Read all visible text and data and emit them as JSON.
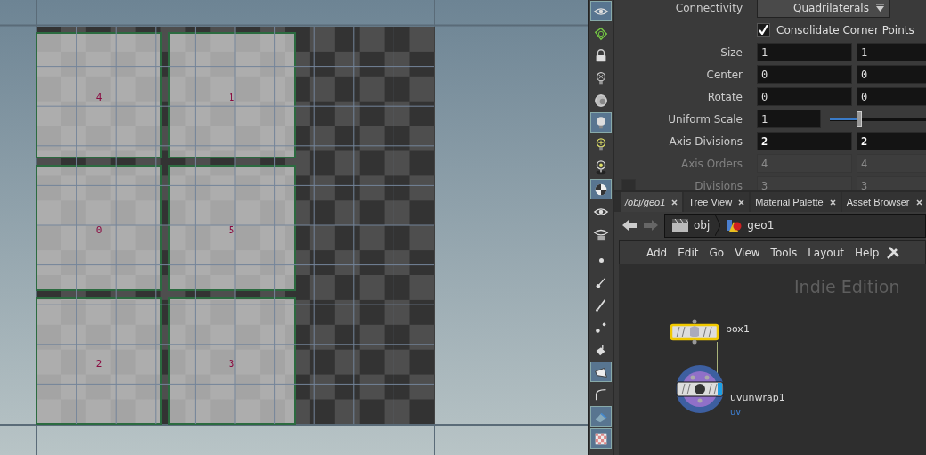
{
  "viewport": {
    "islands": [
      {
        "label": "4"
      },
      {
        "label": "1"
      },
      {
        "label": "0"
      },
      {
        "label": "5"
      },
      {
        "label": "2"
      },
      {
        "label": "3"
      }
    ]
  },
  "toolbar": {
    "groups": [
      [
        {
          "kind": "eye",
          "selected": true
        },
        {
          "kind": "wire",
          "selected": false
        },
        {
          "kind": "lock",
          "selected": false
        },
        {
          "kind": "bulb-x",
          "selected": false
        },
        {
          "kind": "sphere",
          "selected": false
        },
        {
          "kind": "bulb",
          "selected": true
        },
        {
          "kind": "bulb-plus",
          "selected": false
        },
        {
          "kind": "bulb-pin",
          "selected": false
        },
        {
          "kind": "ball",
          "selected": true
        },
        {
          "kind": "eye",
          "selected": false
        },
        {
          "kind": "eye-cam",
          "selected": false
        }
      ],
      [
        {
          "kind": "dot",
          "selected": false
        },
        {
          "kind": "brush",
          "selected": false
        },
        {
          "kind": "pen",
          "selected": false
        },
        {
          "kind": "points",
          "selected": false
        },
        {
          "kind": "bucket",
          "selected": false
        },
        {
          "kind": "tag",
          "selected": true
        },
        {
          "kind": "curve",
          "selected": false
        },
        {
          "kind": "plane",
          "selected": true
        },
        {
          "kind": "checker",
          "selected": true
        }
      ]
    ]
  },
  "parameters": [
    {
      "kind": "menu",
      "label": "Connectivity",
      "value": "Quadrilaterals"
    },
    {
      "kind": "toggle",
      "label": "Consolidate Corner Points",
      "checked": true
    },
    {
      "kind": "vector",
      "label": "Size",
      "values": [
        "1",
        "1"
      ],
      "changed": false,
      "disabled": false
    },
    {
      "kind": "vector",
      "label": "Center",
      "values": [
        "0",
        "0"
      ],
      "changed": false,
      "disabled": false
    },
    {
      "kind": "vector",
      "label": "Rotate",
      "values": [
        "0",
        "0"
      ],
      "changed": false,
      "disabled": false
    },
    {
      "kind": "slider",
      "label": "Uniform Scale",
      "value": "1",
      "level": 0.22
    },
    {
      "kind": "vector",
      "label": "Axis Divisions",
      "values": [
        "2",
        "2"
      ],
      "changed": true,
      "disabled": false
    },
    {
      "kind": "vector",
      "label": "Axis Orders",
      "values": [
        "4",
        "4"
      ],
      "changed": false,
      "disabled": true
    },
    {
      "kind": "toggled-vector",
      "label": "Divisions",
      "values": [
        "3",
        "3"
      ],
      "checked": false,
      "changed": false,
      "disabled": true
    }
  ],
  "tabs": [
    {
      "label": "/obj/geo1",
      "selected": true
    },
    {
      "label": "Tree View",
      "selected": false
    },
    {
      "label": "Material Palette",
      "selected": false
    },
    {
      "label": "Asset Browser",
      "selected": false
    }
  ],
  "path": [
    {
      "kind": "obj",
      "label": "obj"
    },
    {
      "kind": "geo",
      "label": "geo1"
    }
  ],
  "menu": [
    "Add",
    "Edit",
    "Go",
    "View",
    "Tools",
    "Layout",
    "Help"
  ],
  "network": {
    "watermark": "Indie Edition",
    "nodes": [
      {
        "kind": "box",
        "name": "box1",
        "selected": true,
        "display": false
      },
      {
        "kind": "uvunwrap",
        "name": "uvunwrap1",
        "subtitle": "uv",
        "selected": false,
        "display": true
      }
    ]
  }
}
